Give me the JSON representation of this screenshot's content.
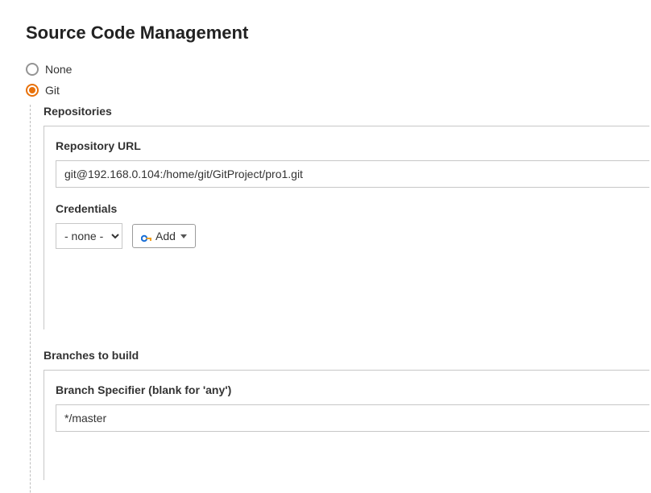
{
  "title": "Source Code Management",
  "scm": {
    "options": {
      "none": "None",
      "git": "Git"
    },
    "selected": "git"
  },
  "repos": {
    "section_label": "Repositories",
    "url_label": "Repository URL",
    "url_value": "git@192.168.0.104:/home/git/GitProject/pro1.git",
    "credentials_label": "Credentials",
    "credentials_selected": "- none -",
    "add_button": "Add"
  },
  "branches": {
    "section_label": "Branches to build",
    "specifier_label": "Branch Specifier (blank for 'any')",
    "specifier_value": "*/master"
  }
}
